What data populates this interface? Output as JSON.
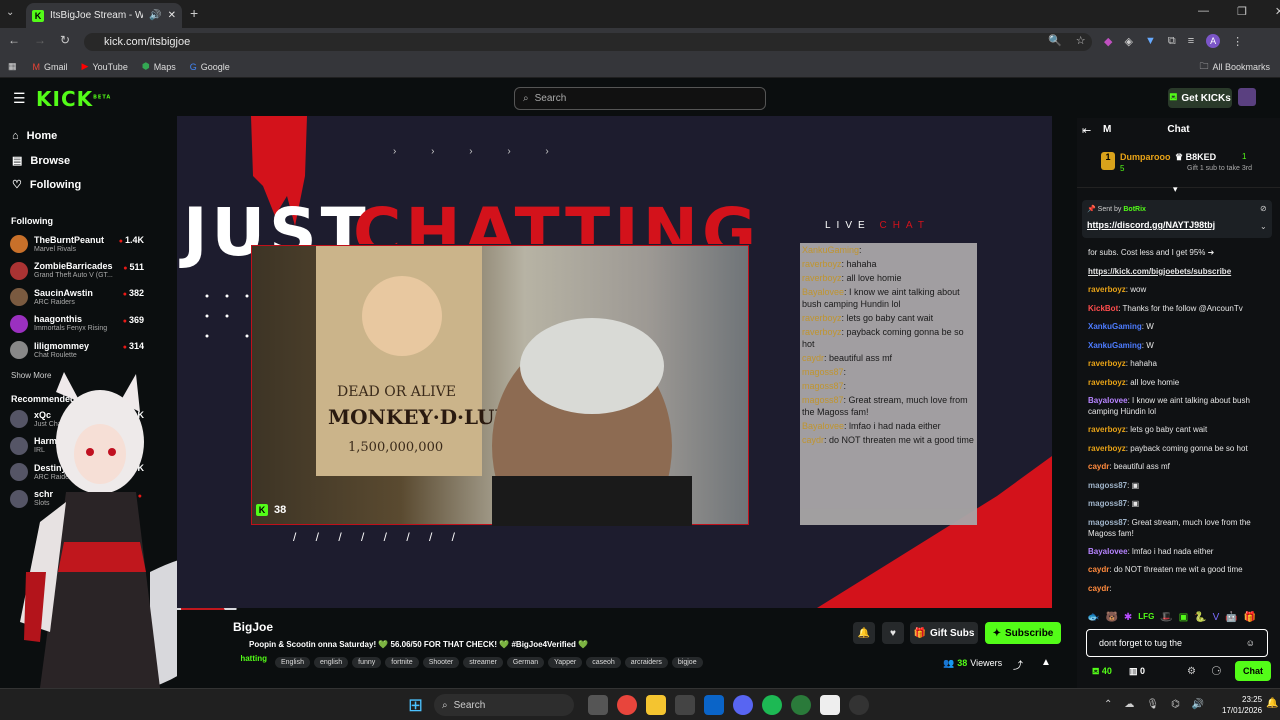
{
  "browser": {
    "tab_title": "ItsBigJoe Stream - Watch L",
    "url": "kick.com/itsbigjoe",
    "bookmarks": [
      "Gmail",
      "YouTube",
      "Maps",
      "Google"
    ],
    "all_bookmarks": "All Bookmarks",
    "profile_initial": "A"
  },
  "header": {
    "logo": "KICK",
    "logo_badge": "BETA",
    "search_placeholder": "Search",
    "get_kicks": "Get KICKs"
  },
  "sidebar": {
    "nav": [
      {
        "label": "Home",
        "icon": "home-icon"
      },
      {
        "label": "Browse",
        "icon": "browse-icon"
      },
      {
        "label": "Following",
        "icon": "heart-icon"
      }
    ],
    "following_title": "Following",
    "following": [
      {
        "name": "TheBurntPeanut",
        "category": "Marvel Rivals",
        "viewers": "1.4K",
        "color": "#c8702a"
      },
      {
        "name": "ZombieBarricades",
        "category": "Grand Theft Auto V (GT...",
        "viewers": "511",
        "color": "#a33"
      },
      {
        "name": "SaucinAwstin",
        "category": "ARC Raiders",
        "viewers": "382",
        "color": "#7a5a40"
      },
      {
        "name": "haagonthis",
        "category": "Immortals Fenyx Rising",
        "viewers": "369",
        "color": "#9b30c0"
      },
      {
        "name": "Iiligmommey",
        "category": "Chat Roulette",
        "viewers": "314",
        "color": "#888"
      }
    ],
    "show_more": "Show More",
    "recommended_title": "Recommended",
    "recommended": [
      {
        "name": "xQc",
        "category": "Just Chatting",
        "viewers": "K"
      },
      {
        "name": "Harmonic",
        "category": "IRL",
        "viewers": "59"
      },
      {
        "name": "Destiny",
        "category": "ARC Raiders",
        "viewers": "2.6K"
      },
      {
        "name": "schr",
        "category": "Slots",
        "viewers": ""
      }
    ]
  },
  "stream": {
    "overlay_title_left": "JUST",
    "overlay_title_right": "CHATTING",
    "live_label": "LIVE",
    "chat_label": "CHAT",
    "cam_viewers": "38",
    "overlay_chat": [
      [
        "XankuGaming",
        ""
      ],
      [
        "raverboyz",
        "hahaha"
      ],
      [
        "raverboyz",
        "all love homie"
      ],
      [
        "Bayalovee",
        "I know we aint talking about bush camping Hundin lol"
      ],
      [
        "raverboyz",
        "lets go baby cant wait"
      ],
      [
        "raverboyz",
        "payback coming gonna be so hot"
      ],
      [
        "caydr",
        "beautiful ass mf"
      ],
      [
        "magoss87",
        ""
      ],
      [
        "magoss87",
        ""
      ],
      [
        "magoss87",
        "Great stream, much love from the Magoss fam!"
      ],
      [
        "Bayalovee",
        "lmfao i had nada either"
      ],
      [
        "caydr",
        "do NOT threaten me wit a good time"
      ]
    ],
    "streamer_name": "BigJoe",
    "title": "Poopin & Scootin onna Saturday! 💚 56.06/50 FOR THAT CHECK! 💚 #BigJoe4Verified 💚",
    "category": "Just Chatting",
    "tags": [
      "English",
      "english",
      "funny",
      "fortnite",
      "Shooter",
      "streamer",
      "German",
      "Yapper",
      "caseoh",
      "arcraiders",
      "bigjoe"
    ],
    "gift_subs": "Gift Subs",
    "subscribe": "Subscribe",
    "viewers": "38",
    "viewers_label": "Viewers"
  },
  "chat": {
    "title": "Chat",
    "mode": "M",
    "leader_name": "Dumparooo",
    "leader_count": "5",
    "leader2": "B8KED",
    "leader2_count": "1",
    "leader2_sub": "Gift 1 sub to take 3rd",
    "pinned_sender": "Sent by",
    "pinned_bot": "BotRix",
    "pinned_link": "https://discord.gg/NAYTJ98tbj",
    "messages": [
      {
        "user": "",
        "text": "for subs. Cost less and I get 95% ➜",
        "color": "#fff"
      },
      {
        "user": "",
        "text": "https://kick.com/bigjoebets/subscribe",
        "color": "#fff",
        "link": true
      },
      {
        "user": "raverboyz",
        "text": "wow",
        "color": "#e8a317"
      },
      {
        "user": "KickBot",
        "text": "Thanks for the follow @AncounTv",
        "color": "#ff4d4d"
      },
      {
        "user": "XankuGaming",
        "text": "W",
        "color": "#4d7cff"
      },
      {
        "user": "XankuGaming",
        "text": "W",
        "color": "#4d7cff"
      },
      {
        "user": "raverboyz",
        "text": "hahaha",
        "color": "#e8a317"
      },
      {
        "user": "raverboyz",
        "text": "all love homie",
        "color": "#e8a317"
      },
      {
        "user": "Bayalovee",
        "text": "I know we aint talking about bush camping Hündin lol",
        "color": "#b784ff"
      },
      {
        "user": "raverboyz",
        "text": "lets go baby cant wait",
        "color": "#e8a317"
      },
      {
        "user": "raverboyz",
        "text": "payback coming gonna be so hot",
        "color": "#e8a317"
      },
      {
        "user": "caydr",
        "text": "beautiful ass mf",
        "color": "#ff8a3d"
      },
      {
        "user": "magoss87",
        "text": "▣",
        "color": "#9fb3c8"
      },
      {
        "user": "magoss87",
        "text": "▣",
        "color": "#9fb3c8"
      },
      {
        "user": "magoss87",
        "text": "Great stream, much love from the Magoss fam!",
        "color": "#9fb3c8"
      },
      {
        "user": "Bayalovee",
        "text": "lmfao i had nada either",
        "color": "#b784ff"
      },
      {
        "user": "caydr",
        "text": "do NOT threaten me wit a good time",
        "color": "#ff8a3d"
      },
      {
        "user": "caydr",
        "text": "",
        "color": "#ff8a3d"
      }
    ],
    "input_value": "dont forget to tug the",
    "kicks_count": "40",
    "points": "0",
    "send": "Chat"
  },
  "taskbar": {
    "search": "Search",
    "time": "23:25",
    "date": "17/01/2026"
  },
  "colors": {
    "kick_green": "#53fc18",
    "bg": "#0b0e0f"
  }
}
